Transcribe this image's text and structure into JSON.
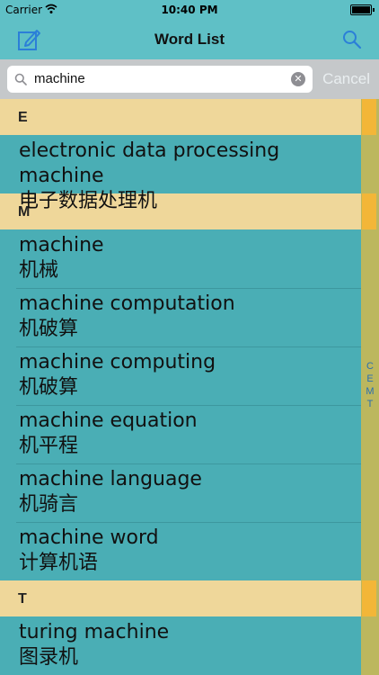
{
  "status_bar": {
    "carrier": "Carrier",
    "time": "10:40 PM"
  },
  "nav": {
    "title": "Word List",
    "left_icon": "compose-icon",
    "right_icon": "search-icon"
  },
  "search": {
    "value": "machine",
    "cancel_label": "Cancel"
  },
  "sections": [
    {
      "letter": "E",
      "rows": [
        {
          "word": "electronic data processing machine",
          "translation": "电子数据处理机"
        }
      ]
    },
    {
      "letter": "M",
      "rows": [
        {
          "word": "machine",
          "translation": "机械"
        },
        {
          "word": "machine computation",
          "translation": "机破算"
        },
        {
          "word": "machine computing",
          "translation": "机破算"
        },
        {
          "word": "machine equation",
          "translation": "机平程"
        },
        {
          "word": "machine language",
          "translation": "机骑言"
        },
        {
          "word": "machine word",
          "translation": "计算机语"
        }
      ]
    },
    {
      "letter": "T",
      "rows": [
        {
          "word": "turing machine",
          "translation": "图录机"
        }
      ]
    }
  ],
  "index": [
    "C",
    "E",
    "M",
    "T"
  ],
  "colors": {
    "list_background": "#4aaeb5",
    "section_header": "#efd79a",
    "nav_bar": "#5fc0c6",
    "accent": "#2b7fd8",
    "index_bar": "#bcb75e",
    "index_marker": "#f3b638"
  }
}
